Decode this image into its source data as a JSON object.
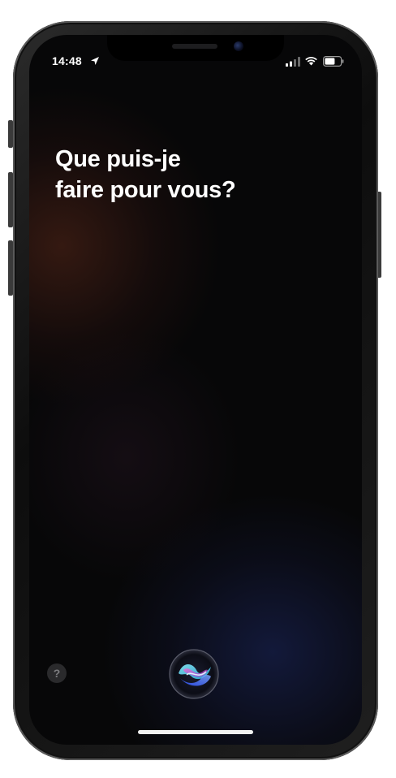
{
  "status_bar": {
    "time": "14:48",
    "icons": [
      "location-arrow-icon",
      "cellular-signal-icon",
      "wifi-icon",
      "battery-icon"
    ]
  },
  "siri": {
    "prompt_line1": "Que puis-je",
    "prompt_line2": "faire pour vous?",
    "help_label": "?"
  },
  "colors": {
    "background": "#070708",
    "text": "#ffffff",
    "orb_cyan": "#5fd4e8",
    "orb_blue": "#3b6cff",
    "orb_magenta": "#d04ac8"
  }
}
